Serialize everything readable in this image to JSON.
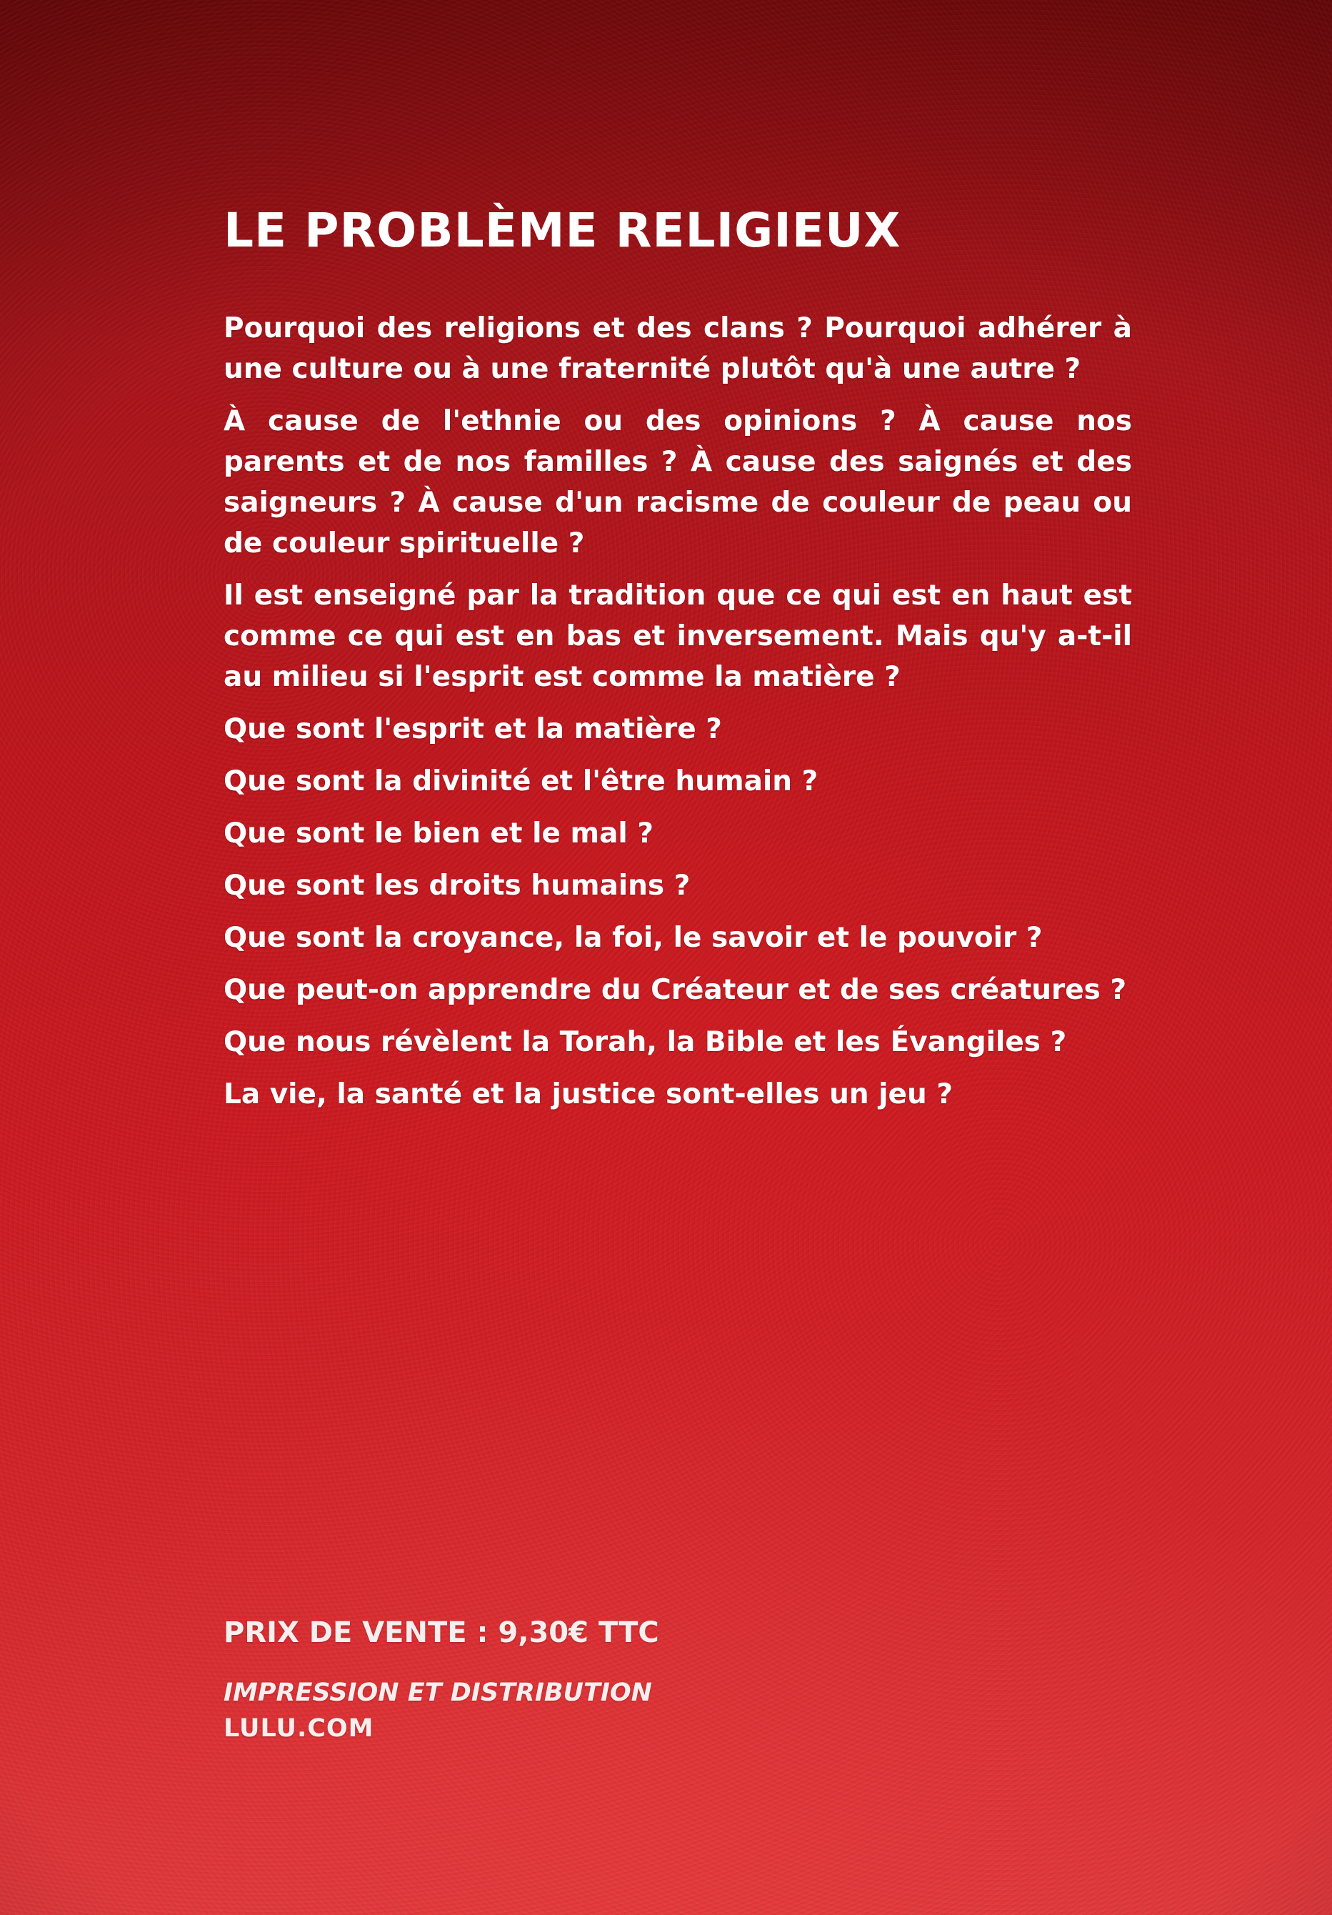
{
  "cover": {
    "title": "LE PROBLÈME RELIGIEUX",
    "paragraphs": [
      "Pourquoi des religions et des clans ? Pourquoi adhérer à une culture ou à une fraternité plutôt qu'à une autre ?",
      "À cause de l'ethnie ou des opinions ? À cause nos parents et de nos familles ? À cause des saignés et des saigneurs ? À cause d'un racisme de couleur de peau ou de couleur spirituelle ?",
      "Il est enseigné par la tradition que ce qui est en haut est comme ce qui est en bas et inversement. Mais qu'y a-t-il au milieu si l'esprit est comme la matière ?",
      "Que sont l'esprit et la matière ?",
      "Que sont la divinité et l'être humain ?",
      "Que sont le bien et le mal ?",
      "Que sont les droits humains ?",
      "Que sont la croyance, la foi, le savoir et le pouvoir ?",
      "Que peut-on apprendre du Créateur et de ses créatures ?",
      "Que nous révèlent la Torah, la Bible et les Évangiles ?",
      "La vie, la santé et la justice sont-elles un jeu ?"
    ],
    "price": "PRIX DE VENTE : 9,30€ TTC",
    "printer_label": "IMPRESSION ET DISTRIBUTION",
    "printer_name": "LULU.COM",
    "background_color": "#c4181f"
  }
}
